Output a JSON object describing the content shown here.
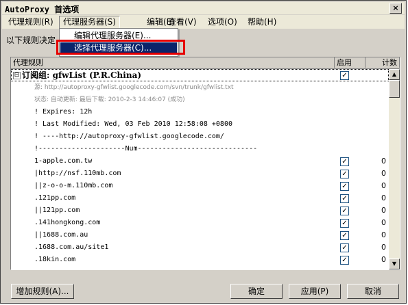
{
  "window": {
    "title": "AutoProxy 首选项",
    "close_glyph": "×"
  },
  "menubar": [
    {
      "label": "代理规则(R)"
    },
    {
      "label": "代理服务器(S)"
    },
    {
      "label": "编辑(E)"
    },
    {
      "label": "查看(V)"
    },
    {
      "label": "选项(O)"
    },
    {
      "label": "帮助(H)"
    }
  ],
  "intro_text": "以下规则决定",
  "dropdown": {
    "items": [
      {
        "label": "编辑代理服务器(E)..."
      },
      {
        "label": "选择代理服务器(C)..."
      }
    ]
  },
  "list": {
    "headers": {
      "rule": "代理规则",
      "enabled": "启用",
      "count": "计数"
    },
    "group": {
      "expander": "⊟",
      "title": "订阅组: gfwList (P.R.China)"
    },
    "meta": [
      "源: http://autoproxy-gfwlist.googlecode.com/svn/trunk/gfwlist.txt",
      "状态: 自动更新: 最后下载: 2010-2-3 14:46:07 (成功)"
    ],
    "comments": [
      "! Expires: 12h",
      "! Last Modified:  Wed, 03 Feb 2010 12:58:08 +0800",
      "!      ----http://autoproxy-gfwlist.googlecode.com/",
      "!---------------------Num-----------------------------"
    ],
    "rules": [
      {
        "text": "1-apple.com.tw",
        "count": "0"
      },
      {
        "text": "|http://nsf.110mb.com",
        "count": "0"
      },
      {
        "text": "||z-o-o-m.110mb.com",
        "count": "0"
      },
      {
        "text": ".121pp.com",
        "count": "0"
      },
      {
        "text": "||121pp.com",
        "count": "0"
      },
      {
        "text": ".141hongkong.com",
        "count": "0"
      },
      {
        "text": "||1688.com.au",
        "count": "0"
      },
      {
        "text": ".1688.com.au/site1",
        "count": "0"
      },
      {
        "text": ".18kin.com",
        "count": "0"
      }
    ],
    "check_glyph": "✓"
  },
  "buttons": {
    "add_rule": "增加规则(A)...",
    "ok": "确定",
    "apply": "应用(P)",
    "cancel": "取消"
  },
  "colors": {
    "highlight": "#0a246a",
    "callout": "#e60000"
  },
  "icons": {
    "scroll_up": "▲",
    "scroll_down": "▼"
  }
}
